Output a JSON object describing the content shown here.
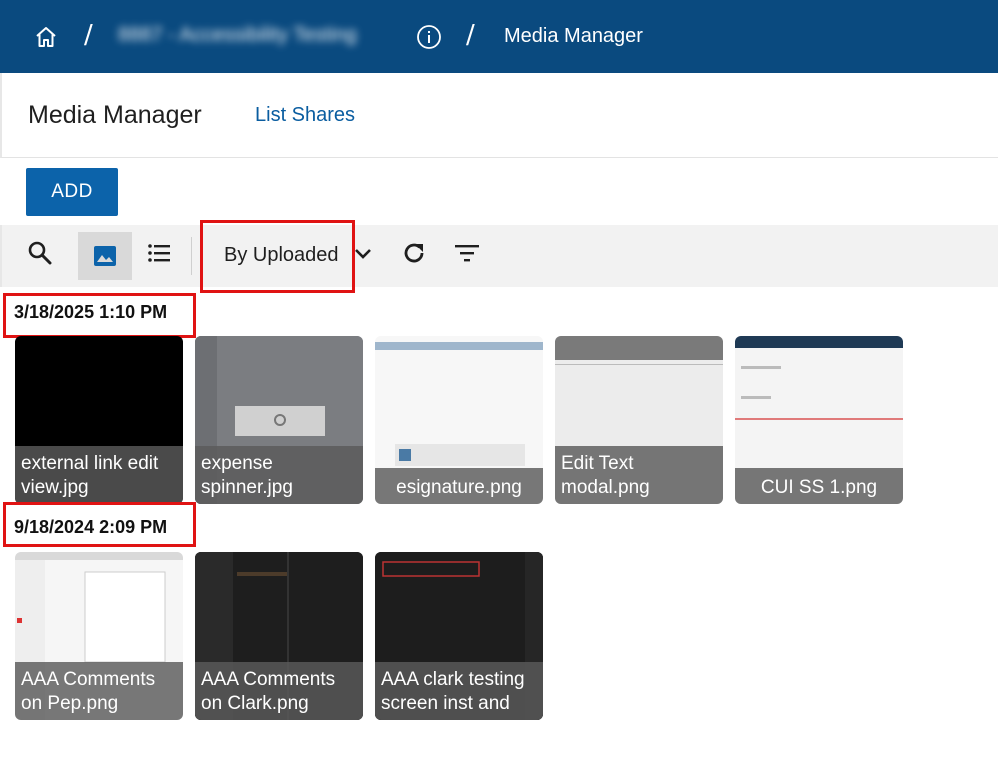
{
  "breadcrumb": {
    "home_icon": "home-icon",
    "separator": "/",
    "project": "8887 - Accessibility Testing",
    "info_icon": "info-icon",
    "current": "Media Manager"
  },
  "header": {
    "title": "Media Manager",
    "list_shares": "List Shares"
  },
  "actions": {
    "add": "ADD"
  },
  "toolbar": {
    "search_icon": "search-icon",
    "grid_view_icon": "image-grid-icon",
    "list_view_icon": "list-icon",
    "sort_label": "By Uploaded",
    "sort_chevron_icon": "chevron-down-icon",
    "refresh_icon": "refresh-icon",
    "filter_icon": "filter-icon"
  },
  "groups": [
    {
      "date": "3/18/2025 1:10 PM",
      "items": [
        {
          "name_line1": "external link edit",
          "name_line2": "view.jpg"
        },
        {
          "name_line1": "expense",
          "name_line2": "spinner.jpg"
        },
        {
          "name_line1": "esignature.png"
        },
        {
          "name_line1": "Edit Text",
          "name_line2": "modal.png"
        },
        {
          "name_line1": "CUI SS 1.png"
        }
      ]
    },
    {
      "date": "9/18/2024 2:09 PM",
      "items": [
        {
          "name_line1": "AAA Comments",
          "name_line2": "on Pep.png"
        },
        {
          "name_line1": "AAA Comments",
          "name_line2": "on Clark.png"
        },
        {
          "name_line1": "AAA clark testing",
          "name_line2": "screen inst and"
        }
      ]
    }
  ],
  "colors": {
    "topbar": "#0a4a7f",
    "primary": "#0c63aa",
    "highlight": "#e01313"
  }
}
